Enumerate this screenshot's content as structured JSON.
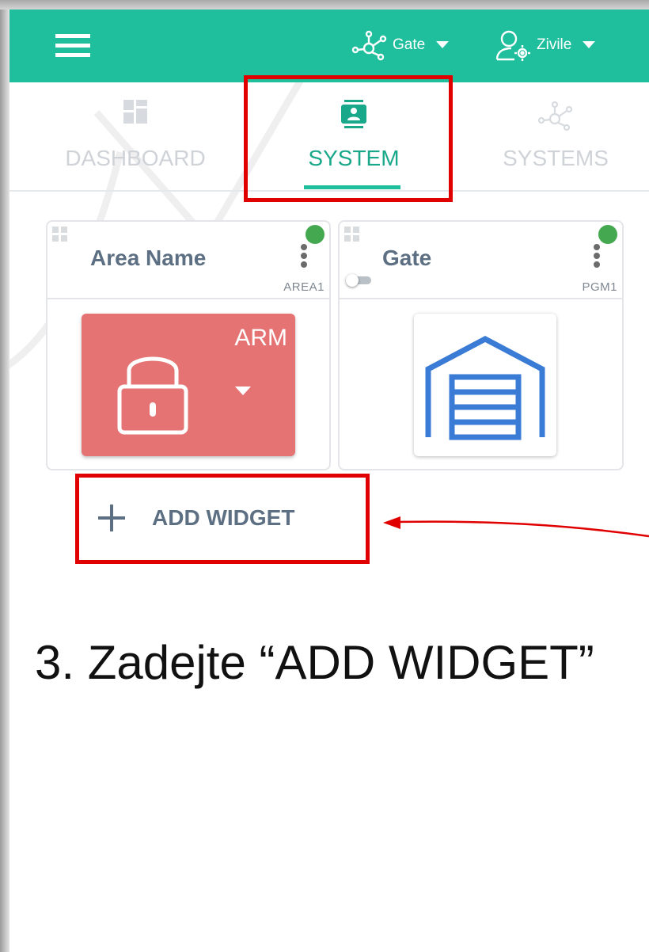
{
  "app_bar": {
    "menu_icon": "hamburger-menu-icon",
    "system_selector": {
      "icon": "network-nodes-icon",
      "label": "Gate"
    },
    "user_selector": {
      "icon": "user-gear-icon",
      "label": "Zivile"
    },
    "background_color": "#1fbe9d"
  },
  "tabs": [
    {
      "label": "DASHBOARD",
      "icon": "dashboard-grid-icon",
      "active": false
    },
    {
      "label": "SYSTEM",
      "icon": "system-contact-icon",
      "active": true
    },
    {
      "label": "SYSTEMS",
      "icon": "network-nodes-icon",
      "active": false
    }
  ],
  "widgets": [
    {
      "title": "Area Name",
      "code": "AREA1",
      "status_color": "#43a84f",
      "action_label": "ARM",
      "action_icon": "padlock-icon",
      "action_color": "#e57373"
    },
    {
      "title": "Gate",
      "code": "PGM1",
      "status_color": "#43a84f",
      "toggle_on": false,
      "action_icon": "garage-gate-icon",
      "action_color": "#3a7bd5"
    }
  ],
  "add_widget": {
    "icon": "plus-icon",
    "label": "ADD WIDGET"
  },
  "annotation": {
    "instruction": "3. Zadejte “ADD WIDGET”",
    "highlight_color": "#e00000"
  }
}
